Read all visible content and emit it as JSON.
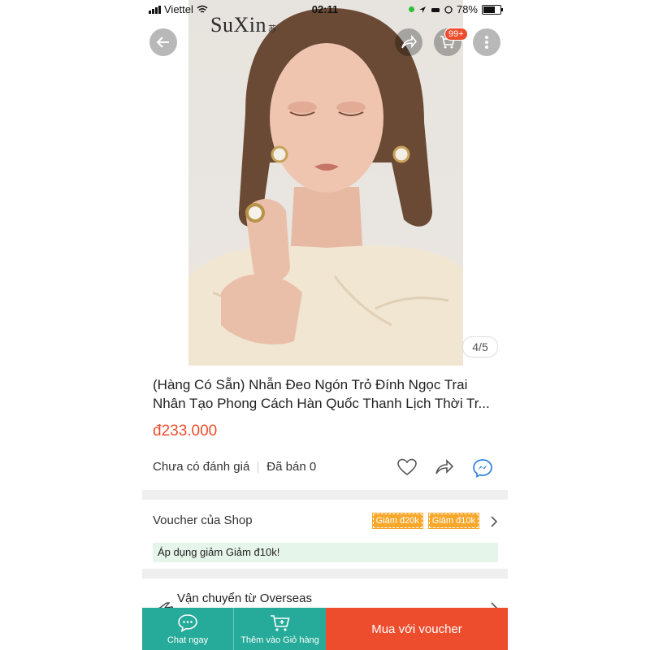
{
  "status_bar": {
    "carrier": "Viettel",
    "time": "02:11",
    "battery": "78%",
    "battery_level": 0.78
  },
  "header": {
    "brand": "SuXin",
    "brand_sub": "苏",
    "cart_badge": "99+"
  },
  "gallery": {
    "page_indicator": "4/5"
  },
  "product": {
    "title": "(Hàng Có Sẵn) Nhẫn Đeo Ngón Trỏ Đính Ngọc Trai Nhân Tạo Phong Cách Hàn Quốc Thanh Lịch Thời Tr...",
    "price": "đ233.000",
    "rating": "Chưa có đánh giá",
    "sold": "Đã bán 0"
  },
  "voucher": {
    "label": "Voucher của Shop",
    "tags": [
      "Giảm đ20k",
      "Giảm đ10k"
    ],
    "apply_text": "Áp dụng giảm Giảm đ10k!"
  },
  "shipping": {
    "label": "Vận chuyển từ Overseas"
  },
  "bottom_bar": {
    "chat": "Chat ngay",
    "add_cart": "Thêm vào Giỏ hàng",
    "buy": "Mua với voucher"
  },
  "colors": {
    "accent": "#ee4d2d",
    "teal": "#26aa99",
    "voucher_tag": "#f7a72a",
    "apply_bg": "#e6f5ea"
  }
}
